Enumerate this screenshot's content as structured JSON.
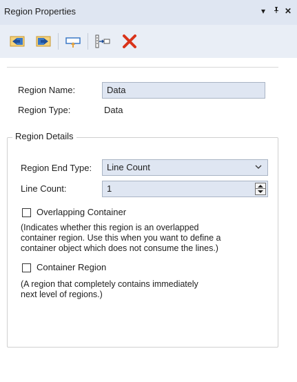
{
  "panel": {
    "title": "Region Properties",
    "dropdown_glyph": "▾",
    "pin_glyph": "ᵖ",
    "close_glyph": "✕"
  },
  "toolbar": {
    "icons": [
      "move-left-icon",
      "move-right-icon",
      "insert-region-icon",
      "insert-after-icon",
      "delete-icon"
    ],
    "accent": "#e8a33a",
    "blue": "#3b78c5",
    "delete_color": "#d9331a"
  },
  "region": {
    "name_label": "Region Name:",
    "name_value": "Data",
    "type_label": "Region Type:",
    "type_value": "Data"
  },
  "details": {
    "legend": "Region Details",
    "end_type_label": "Region End Type:",
    "end_type_value": "Line Count",
    "line_count_label": "Line Count:",
    "line_count_value": "1",
    "overlapping_label": "Overlapping Container",
    "overlapping_checked": false,
    "overlapping_note_1": "(Indicates whether this region is an overlapped",
    "overlapping_note_2": "container region. Use this when you want to define a",
    "overlapping_note_3": "container object which does not consume the lines.)",
    "container_label": "Container Region",
    "container_checked": false,
    "container_note_1": "(A region that completely contains immediately",
    "container_note_2": "next level of regions.)"
  }
}
